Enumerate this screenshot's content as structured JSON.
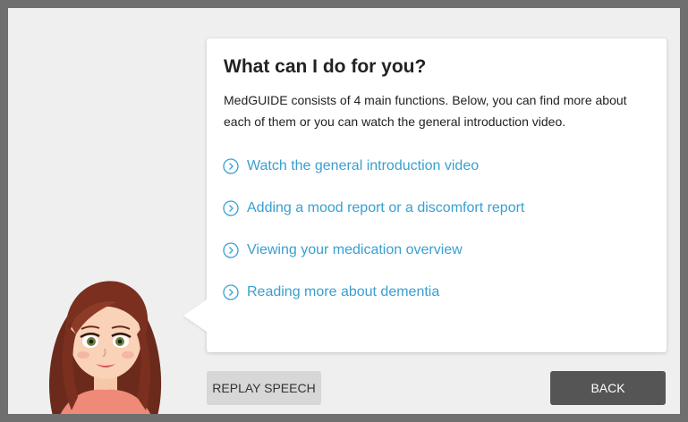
{
  "dialog": {
    "title": "What can I do for you?",
    "intro": "MedGUIDE consists of 4 main functions. Below, you can find more about each of them or you can watch the general introduction video.",
    "links": [
      {
        "label": "Watch the general introduction video",
        "icon": "chevron-circle-right-icon"
      },
      {
        "label": "Adding a mood report or a discomfort report",
        "icon": "chevron-circle-right-icon"
      },
      {
        "label": "Viewing your medication overview",
        "icon": "chevron-circle-right-icon"
      },
      {
        "label": "Reading more about dementia",
        "icon": "chevron-circle-right-icon"
      }
    ]
  },
  "buttons": {
    "replay_label": "REPLAY SPEECH",
    "back_label": "BACK"
  },
  "colors": {
    "link": "#3a9fd0",
    "back_button": "#555555",
    "replay_button": "#d7d7d7",
    "frame": "#6f6f6f",
    "background": "#efefef"
  }
}
